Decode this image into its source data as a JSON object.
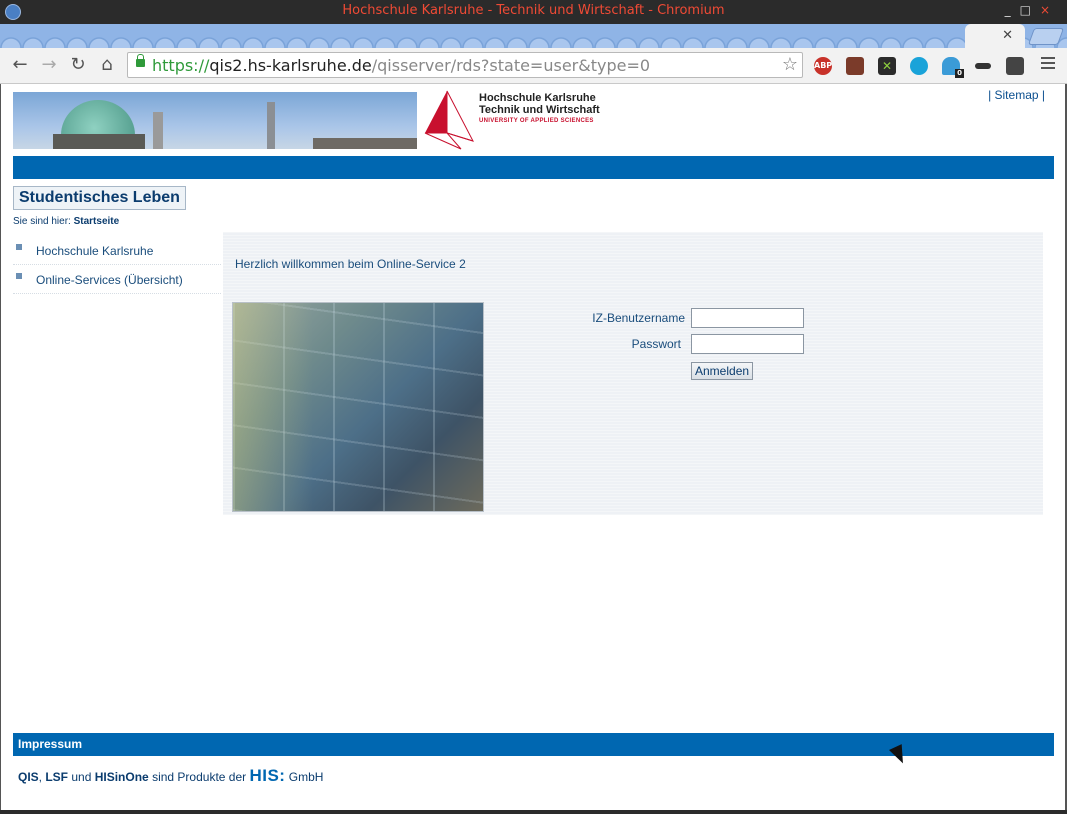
{
  "window": {
    "title": "Hochschule Karlsruhe - Technik und Wirtschaft - Chromium",
    "controls": [
      "_",
      "□",
      "×"
    ]
  },
  "browser": {
    "url_scheme": "https://",
    "url_host": "qis2.hs-karlsruhe.de",
    "url_path": "/qisserver/rds?state=user&type=0",
    "extensions": [
      {
        "name": "adblock-icon",
        "label": "ABP",
        "color": "#c8322a"
      },
      {
        "name": "clapper-icon",
        "label": "",
        "color": "#7b3b2a"
      },
      {
        "name": "x-extension-icon",
        "label": "",
        "color": "#2b2b2b"
      },
      {
        "name": "share-icon",
        "label": "",
        "color": "#1aa3d9"
      },
      {
        "name": "ghostery-icon",
        "label": "0",
        "color": "#3b9bd7"
      },
      {
        "name": "mask-icon",
        "label": "",
        "color": "#333333"
      },
      {
        "name": "glasses-icon",
        "label": "",
        "color": "#444444"
      }
    ]
  },
  "header": {
    "logo_line1": "Hochschule Karlsruhe",
    "logo_line2": "Technik und Wirtschaft",
    "logo_line3": "UNIVERSITY OF APPLIED SCIENCES",
    "sitemap": "| Sitemap |"
  },
  "section": {
    "title": "Studentisches Leben",
    "breadcrumb_prefix": "Sie sind hier:",
    "breadcrumb_current": "Startseite"
  },
  "sidebar": {
    "items": [
      {
        "label": "Hochschule Karlsruhe"
      },
      {
        "label": "Online-Services (Übersicht)"
      }
    ]
  },
  "main": {
    "welcome": "Herzlich willkommen beim Online-Service 2",
    "username_label": "IZ-Benutzername",
    "password_label": "Passwort",
    "username_value": "",
    "password_value": "",
    "login_button": "Anmelden"
  },
  "footer": {
    "impressum": "Impressum",
    "qis": "QIS",
    "sep1": ", ",
    "lsf": "LSF",
    "und": " und ",
    "hisinone": "HISinOne",
    "sind": " sind Produkte der ",
    "his": "HIS:",
    "gmbh": " GmbH"
  },
  "colors": {
    "brand_blue": "#0067b1",
    "brand_red": "#c8102e",
    "text_blue": "#1a4d7c"
  }
}
